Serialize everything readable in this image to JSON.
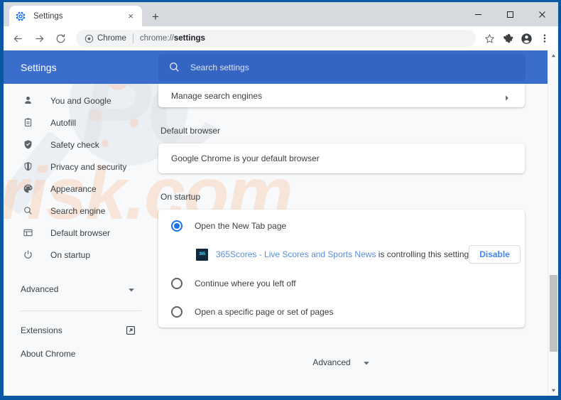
{
  "window": {
    "controls": [
      {
        "name": "minimize",
        "glyph": "minimize-icon"
      },
      {
        "name": "maximize",
        "glyph": "maximize-icon"
      },
      {
        "name": "close",
        "glyph": "close-icon"
      }
    ]
  },
  "tab": {
    "title": "Settings",
    "favicon": "gear-icon",
    "close_label": "×",
    "new_tab_label": "+"
  },
  "toolbar": {
    "back_icon": "back-arrow-icon",
    "forward_icon": "forward-arrow-icon",
    "reload_icon": "reload-icon",
    "omnibox": {
      "chip_icon": "chrome-icon",
      "chip_label": "Chrome",
      "url_prefix": "chrome://",
      "url_bold": "settings"
    },
    "bookmark_icon": "star-icon",
    "extensions_icon": "puzzle-icon",
    "profile_icon": "profile-avatar-icon",
    "menu_icon": "three-dot-menu-icon"
  },
  "settings_header": {
    "title": "Settings",
    "search_icon": "search-icon",
    "search_placeholder": "Search settings",
    "search_value": ""
  },
  "sidebar": {
    "items": [
      {
        "label": "You and Google",
        "icon": "person-icon"
      },
      {
        "label": "Autofill",
        "icon": "clipboard-icon"
      },
      {
        "label": "Safety check",
        "icon": "shield-check-icon"
      },
      {
        "label": "Privacy and security",
        "icon": "shield-icon"
      },
      {
        "label": "Appearance",
        "icon": "palette-icon"
      },
      {
        "label": "Search engine",
        "icon": "magnifier-icon"
      },
      {
        "label": "Default browser",
        "icon": "browser-window-icon"
      },
      {
        "label": "On startup",
        "icon": "power-icon"
      }
    ],
    "advanced": {
      "label": "Advanced",
      "caret": "chevron-down-icon"
    },
    "footer": [
      {
        "label": "Extensions",
        "icon": "external-link-icon"
      },
      {
        "label": "About Chrome",
        "icon": ""
      }
    ]
  },
  "main": {
    "manage_search_engines": {
      "label": "Manage search engines",
      "arrow": "chevron-right-icon"
    },
    "default_browser": {
      "section_title": "Default browser",
      "status": "Google Chrome is your default browser"
    },
    "on_startup": {
      "section_title": "On startup",
      "options": [
        {
          "label": "Open the New Tab page",
          "selected": true
        },
        {
          "label": "Continue where you left off",
          "selected": false
        },
        {
          "label": "Open a specific page or set of pages",
          "selected": false
        }
      ],
      "extension_notice": {
        "favicon_text": "365",
        "extension_name": "365Scores - Live Scores and Sports News",
        "suffix": " is controlling this setting",
        "button_label": "Disable"
      }
    },
    "advanced_footer": {
      "label": "Advanced",
      "caret": "chevron-down-icon"
    }
  },
  "scrollbar": {
    "up_arrow": "scroll-up-arrow-icon",
    "down_arrow": "scroll-down-arrow-icon"
  },
  "watermark": {
    "primary": "PC",
    "secondary": "risk.com"
  },
  "colors": {
    "frame_blue": "#0a57a4",
    "header_blue": "#3b6ecc",
    "accent_blue": "#1a73e8",
    "link_blue": "#5b8dd9",
    "button_blue": "#4285f4",
    "page_bg": "#f8f9fa"
  }
}
